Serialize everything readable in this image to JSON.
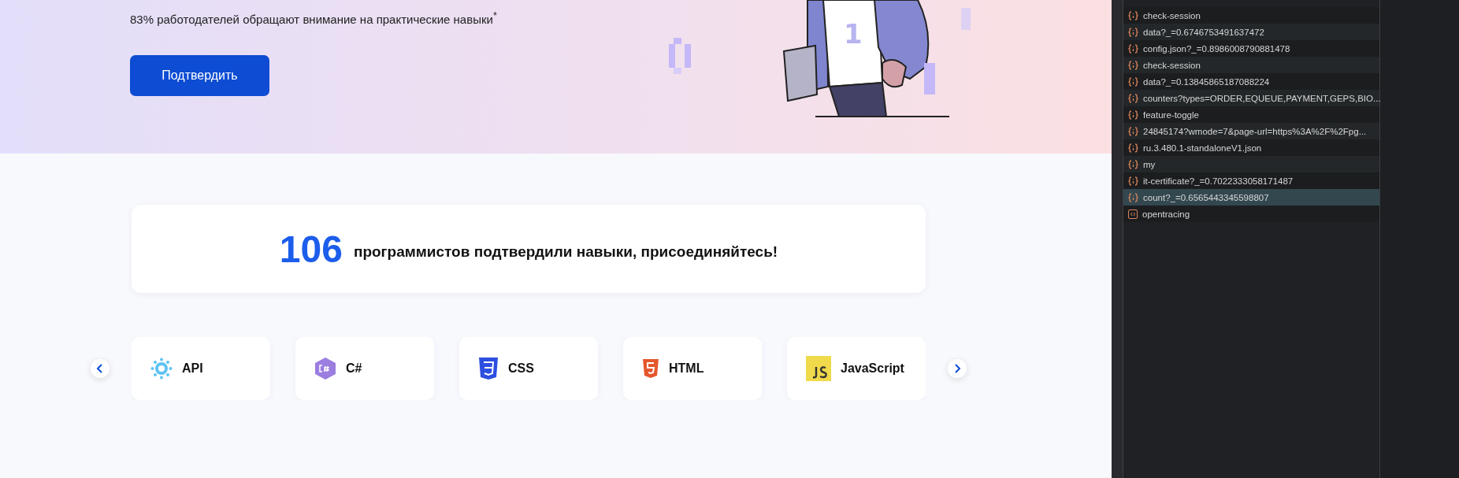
{
  "hero": {
    "subtitle": "83% работодателей обращают внимание на практические навыки",
    "footnote_mark": "*",
    "button": "Подтвердить",
    "shirt_number": "1"
  },
  "stats": {
    "count": "106",
    "text": "программистов подтвердили навыки, присоединяйтесь!"
  },
  "skills": [
    {
      "label": "API",
      "kind": "api"
    },
    {
      "label": "C#",
      "kind": "csharp"
    },
    {
      "label": "CSS",
      "kind": "css"
    },
    {
      "label": "HTML",
      "kind": "html"
    },
    {
      "label": "JavaScript",
      "kind": "js"
    }
  ],
  "network": {
    "requests": [
      {
        "name": "check-session",
        "kind": "xhr",
        "selected": false
      },
      {
        "name": "data?_=0.6746753491637472",
        "kind": "xhr",
        "selected": false
      },
      {
        "name": "config.json?_=0.8986008790881478",
        "kind": "xhr",
        "selected": false
      },
      {
        "name": "check-session",
        "kind": "xhr",
        "selected": false
      },
      {
        "name": "data?_=0.13845865187088224",
        "kind": "xhr",
        "selected": false
      },
      {
        "name": "counters?types=ORDER,EQUEUE,PAYMENT,GEPS,BIO...",
        "kind": "xhr",
        "selected": false
      },
      {
        "name": "feature-toggle",
        "kind": "xhr",
        "selected": false
      },
      {
        "name": "24845174?wmode=7&page-url=https%3A%2F%2Fpg...",
        "kind": "xhr",
        "selected": false
      },
      {
        "name": "ru.3.480.1-standaloneV1.json",
        "kind": "xhr",
        "selected": false
      },
      {
        "name": "my",
        "kind": "xhr",
        "selected": false
      },
      {
        "name": "it-certificate?_=0.7022333058171487",
        "kind": "xhr",
        "selected": false
      },
      {
        "name": "count?_=0.6565443345598807",
        "kind": "xhr",
        "selected": true
      },
      {
        "name": "opentracing",
        "kind": "doc",
        "selected": false
      }
    ]
  }
}
